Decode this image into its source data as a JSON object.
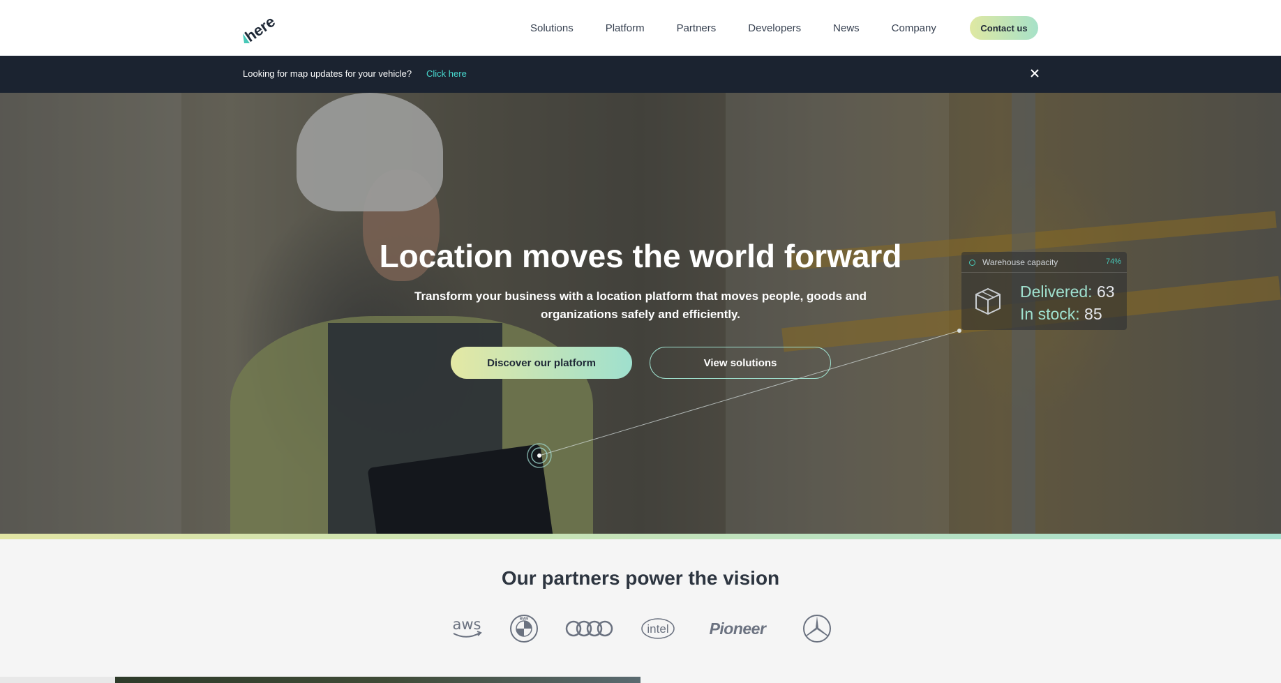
{
  "header": {
    "logo_text": "here",
    "nav": [
      "Solutions",
      "Platform",
      "Partners",
      "Developers",
      "News",
      "Company"
    ],
    "contact_label": "Contact us"
  },
  "notice": {
    "text": "Looking for map updates for your vehicle?",
    "link": "Click here",
    "close_icon": "close-icon"
  },
  "hero": {
    "title": "Location moves the world forward",
    "subtitle": "Transform your business with a location platform that moves people, goods and organizations safely and efficiently.",
    "primary_button": "Discover our platform",
    "secondary_button": "View solutions",
    "widget": {
      "title": "Warehouse capacity",
      "percent": "74%",
      "delivered_label": "Delivered:",
      "delivered_value": "63",
      "stock_label": "In stock:",
      "stock_value": "85",
      "icon": "box-icon"
    }
  },
  "partners": {
    "title": "Our partners power the vision",
    "logos": [
      {
        "name": "aws",
        "icon": "aws-logo",
        "text": "aws"
      },
      {
        "name": "bmw",
        "icon": "bmw-logo",
        "text": "BMW"
      },
      {
        "name": "audi",
        "icon": "audi-logo",
        "text": ""
      },
      {
        "name": "intel",
        "icon": "intel-logo",
        "text": "intel"
      },
      {
        "name": "pioneer",
        "icon": "pioneer-logo",
        "text": "Pioneer"
      },
      {
        "name": "mercedes",
        "icon": "mercedes-logo",
        "text": ""
      }
    ]
  },
  "colors": {
    "accent_start": "#e2e5a4",
    "accent_end": "#a6e0cf",
    "notice_bg": "#1b2330",
    "link": "#48dad0"
  }
}
